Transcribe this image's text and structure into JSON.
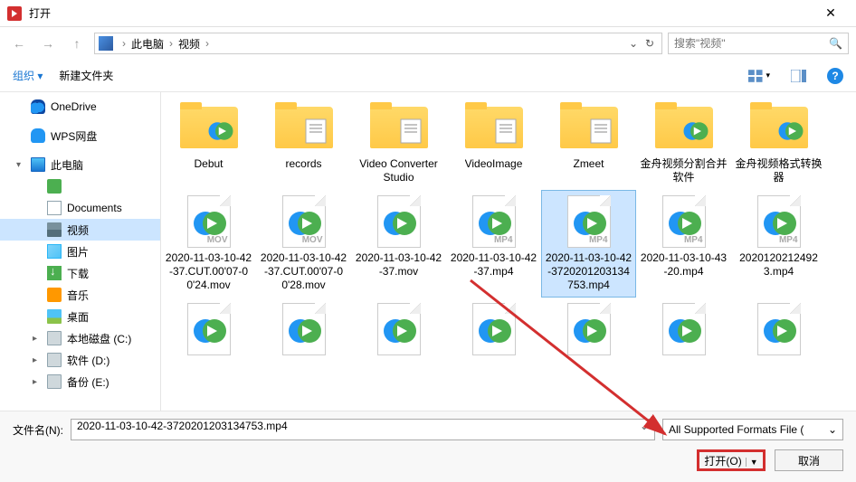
{
  "title": "打开",
  "nav": {
    "breadcrumb": [
      "此电脑",
      "视频"
    ],
    "refresh": "↻"
  },
  "search": {
    "placeholder": "搜索\"视频\""
  },
  "toolbar": {
    "organize": "组织",
    "newfolder": "新建文件夹"
  },
  "sidebar": {
    "items": [
      {
        "icon": "onedrive",
        "label": "OneDrive",
        "child": false
      },
      {
        "icon": "wps",
        "label": "WPS网盘",
        "child": false
      },
      {
        "icon": "pc",
        "label": "此电脑",
        "child": false,
        "exp": "▾"
      },
      {
        "icon": "green",
        "label": "",
        "child": true
      },
      {
        "icon": "doc",
        "label": "Documents",
        "child": true
      },
      {
        "icon": "vid",
        "label": "视频",
        "child": true,
        "selected": true
      },
      {
        "icon": "img",
        "label": "图片",
        "child": true
      },
      {
        "icon": "dl",
        "label": "下载",
        "child": true
      },
      {
        "icon": "music",
        "label": "音乐",
        "child": true
      },
      {
        "icon": "desk",
        "label": "桌面",
        "child": true
      },
      {
        "icon": "disk",
        "label": "本地磁盘 (C:)",
        "child": true,
        "exp": "▸"
      },
      {
        "icon": "disk",
        "label": "软件 (D:)",
        "child": true,
        "exp": "▸"
      },
      {
        "icon": "disk",
        "label": "备份 (E:)",
        "child": true,
        "exp": "▸"
      }
    ]
  },
  "files": [
    {
      "type": "folder",
      "name": "Debut",
      "inner": "video"
    },
    {
      "type": "folder",
      "name": "records",
      "inner": "stripes"
    },
    {
      "type": "folder",
      "name": "Video Converter Studio",
      "inner": "stripes"
    },
    {
      "type": "folder",
      "name": "VideoImage",
      "inner": "stripes"
    },
    {
      "type": "folder",
      "name": "Zmeet",
      "inner": "stripes"
    },
    {
      "type": "folder",
      "name": "金舟视频分割合并软件",
      "inner": "video"
    },
    {
      "type": "folder",
      "name": "金舟视频格式转换器",
      "inner": "video"
    },
    {
      "type": "video",
      "name": "2020-11-03-10-42-37.CUT.00'07-00'24.mov",
      "ext": "MOV"
    },
    {
      "type": "video",
      "name": "2020-11-03-10-42-37.CUT.00'07-00'28.mov",
      "ext": "MOV"
    },
    {
      "type": "video",
      "name": "2020-11-03-10-42-37.mov",
      "ext": ""
    },
    {
      "type": "video",
      "name": "2020-11-03-10-42-37.mp4",
      "ext": "MP4"
    },
    {
      "type": "video",
      "name": "2020-11-03-10-42-3720201203134753.mp4",
      "ext": "MP4",
      "selected": true
    },
    {
      "type": "video",
      "name": "2020-11-03-10-43-20.mp4",
      "ext": "MP4"
    },
    {
      "type": "video",
      "name": "2020120212492 3.mp4",
      "ext": "MP4"
    },
    {
      "type": "video",
      "name": "",
      "ext": ""
    },
    {
      "type": "video",
      "name": "",
      "ext": ""
    },
    {
      "type": "video",
      "name": "",
      "ext": ""
    },
    {
      "type": "video",
      "name": "",
      "ext": ""
    },
    {
      "type": "video",
      "name": "",
      "ext": ""
    },
    {
      "type": "video",
      "name": "",
      "ext": ""
    },
    {
      "type": "video",
      "name": "",
      "ext": ""
    }
  ],
  "footer": {
    "filename_label": "文件名(N):",
    "filename_value": "2020-11-03-10-42-3720201203134753.mp4",
    "filter": "All Supported Formats File (",
    "open": "打开(O)",
    "cancel": "取消"
  }
}
